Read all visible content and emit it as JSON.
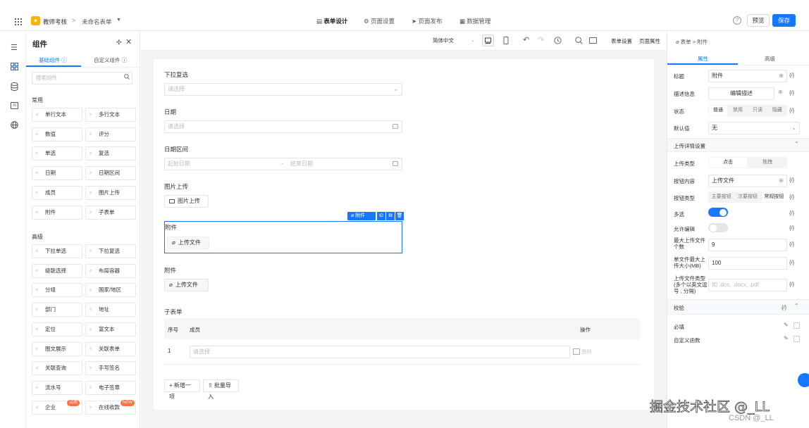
{
  "topbar": {
    "app_name": "教师考核",
    "breadcrumb_sep": ">",
    "form_name": "未命名表单",
    "tabs": [
      {
        "label": "表单设计",
        "icon": "document-icon",
        "active": true
      },
      {
        "label": "页面设置",
        "icon": "gear-icon",
        "active": false
      },
      {
        "label": "页面发布",
        "icon": "send-icon",
        "active": false
      },
      {
        "label": "数据管理",
        "icon": "grid-icon",
        "active": false
      }
    ],
    "preview_label": "预览",
    "save_label": "保存",
    "accent": "#1677ff"
  },
  "components_panel": {
    "title": "组件",
    "tab_basic": "基础组件 ⓘ",
    "tab_custom": "自定义组件 ⓘ",
    "search_placeholder": "搜索组件",
    "section_common": "常用",
    "section_advanced": "高级",
    "common_items": [
      "单行文本",
      "多行文本",
      "数值",
      "评分",
      "单选",
      "复选",
      "日期",
      "日期区间",
      "成员",
      "图片上传",
      "附件",
      "子表单"
    ],
    "advanced_items": [
      "下拉单选",
      "下拉复选",
      "级联选择",
      "布局容器",
      "分组",
      "国家/地区",
      "部门",
      "地址",
      "定位",
      "富文本",
      "图文展示",
      "关联表单",
      "关联查询",
      "手写签名",
      "流水号",
      "电子签章",
      "企业",
      "在线收款"
    ],
    "badge_trial": "试用",
    "badge_new": "NEW"
  },
  "toolbar": {
    "language": "简体中文",
    "form_settings": "表单设置",
    "page_props": "页面属性"
  },
  "form": {
    "dropdown_multi_label": "下拉复选",
    "dropdown_multi_placeholder": "请选择",
    "date_label": "日期",
    "date_placeholder": "请选择",
    "date_range_label": "日期区间",
    "date_range_start": "起始日期",
    "date_range_sep": "-",
    "date_range_end": "结束日期",
    "image_upload_label": "图片上传",
    "image_upload_button": "图片上传",
    "selected_tag": "附件",
    "selected_field_label": "附件",
    "selected_upload_button": "上传文件",
    "attachment_label": "附件",
    "attachment_button": "上传文件",
    "subform_label": "子表单",
    "subform_headers": {
      "index": "序号",
      "member": "成员",
      "action": "操作"
    },
    "subform_row": {
      "index": "1",
      "placeholder": "请选择",
      "action": "删除"
    },
    "add_row": "新增一项",
    "batch_import": "批量导入"
  },
  "right_panel": {
    "breadcrumb_root": "表单",
    "breadcrumb_current": "附件",
    "tab_props": "属性",
    "tab_advanced": "高级",
    "title_label": "标题",
    "title_value": "附件",
    "desc_label": "描述信息",
    "desc_button": "编辑描述",
    "state_label": "状态",
    "state_options": [
      "普通",
      "禁用",
      "只读",
      "隐藏"
    ],
    "default_label": "默认值",
    "default_value": "无",
    "upload_section": "上传详情设置",
    "upload_type_label": "上传类型",
    "upload_type_options": [
      "点击",
      "拖拽"
    ],
    "button_content_label": "按钮内容",
    "button_content_value": "上传文件",
    "button_type_label": "按钮类型",
    "button_type_options": [
      "主要按钮",
      "次要按钮",
      "常规按钮"
    ],
    "multi_label": "多选",
    "multi_on": true,
    "allow_edit_label": "允许编辑",
    "allow_edit_on": false,
    "max_count_label": "最大上传文件个数",
    "max_count_value": "9",
    "max_size_label": "单文件最大上传大小(MB)",
    "max_size_value": "100",
    "file_types_label": "上传文件类型(多个以英文逗号 , 分隔)",
    "file_types_placeholder": "如 .doc, .docx, .pdf",
    "validation_section": "校验",
    "required_label": "必填",
    "custom_func_label": "自定义函数",
    "code_icon_text": "{/}"
  },
  "watermark": "掘金技术社区 @_LL",
  "watermark_sub": "CSDN @_LL"
}
